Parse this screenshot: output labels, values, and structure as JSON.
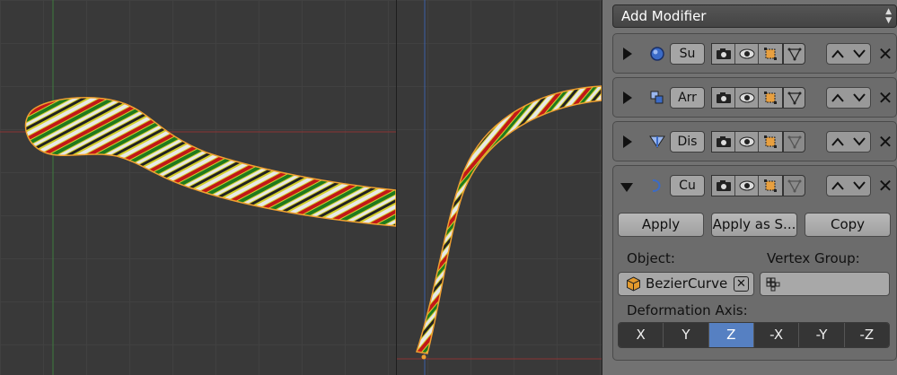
{
  "add_modifier": {
    "label": "Add Modifier"
  },
  "modifiers": [
    {
      "name": "Su",
      "icon": "subdivision-icon",
      "expanded": false
    },
    {
      "name": "Arr",
      "icon": "array-icon",
      "expanded": false
    },
    {
      "name": "Dis",
      "icon": "displace-icon",
      "expanded": false
    },
    {
      "name": "Cu",
      "icon": "curve-modifier-icon",
      "expanded": true
    }
  ],
  "curve_modifier": {
    "apply_label": "Apply",
    "apply_as_label": "Apply as S...",
    "copy_label": "Copy",
    "object_label": "Object:",
    "object_value": "BezierCurve",
    "vertex_group_label": "Vertex Group:",
    "vertex_group_value": "",
    "deformation_axis_label": "Deformation Axis:",
    "axes": [
      "X",
      "Y",
      "Z",
      "-X",
      "-Y",
      "-Z"
    ],
    "selected_axis": "Z"
  },
  "colors": {
    "selection_outline": "#f0a030",
    "axis_selected": "#5680c2",
    "rope_colors": [
      "#d4d02a",
      "#e8e8e8",
      "#c21818",
      "#1f7a1f",
      "#222222"
    ]
  }
}
